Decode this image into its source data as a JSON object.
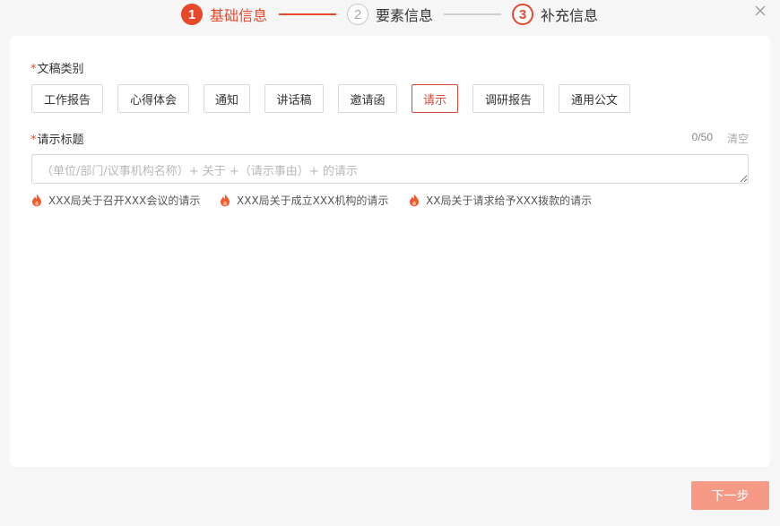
{
  "steps": [
    {
      "num": "1",
      "label": "基础信息"
    },
    {
      "num": "2",
      "label": "要素信息"
    },
    {
      "num": "3",
      "label": "补充信息"
    }
  ],
  "colors": {
    "accent": "#e8472a",
    "next_button": "#f69a86"
  },
  "form": {
    "type_label": "文稿类别",
    "required_mark": "*",
    "types": [
      "工作报告",
      "心得体会",
      "通知",
      "讲话稿",
      "邀请函",
      "请示",
      "调研报告",
      "通用公文"
    ],
    "selected_type": "请示",
    "title_label": "请示标题",
    "counter": "0/50",
    "clear_label": "清空",
    "title_placeholder": "（单位/部门/议事机构名称）+ 关于 +（请示事由）+ 的请示",
    "title_value": "",
    "suggestions": [
      "XXX局关于召开XXX会议的请示",
      "XXX局关于成立XXX机构的请示",
      "XX局关于请求给予XXX拨款的请示"
    ]
  },
  "footer": {
    "next_label": "下一步"
  },
  "icons": {
    "close": "close-icon",
    "suggestion": "flame-icon"
  }
}
